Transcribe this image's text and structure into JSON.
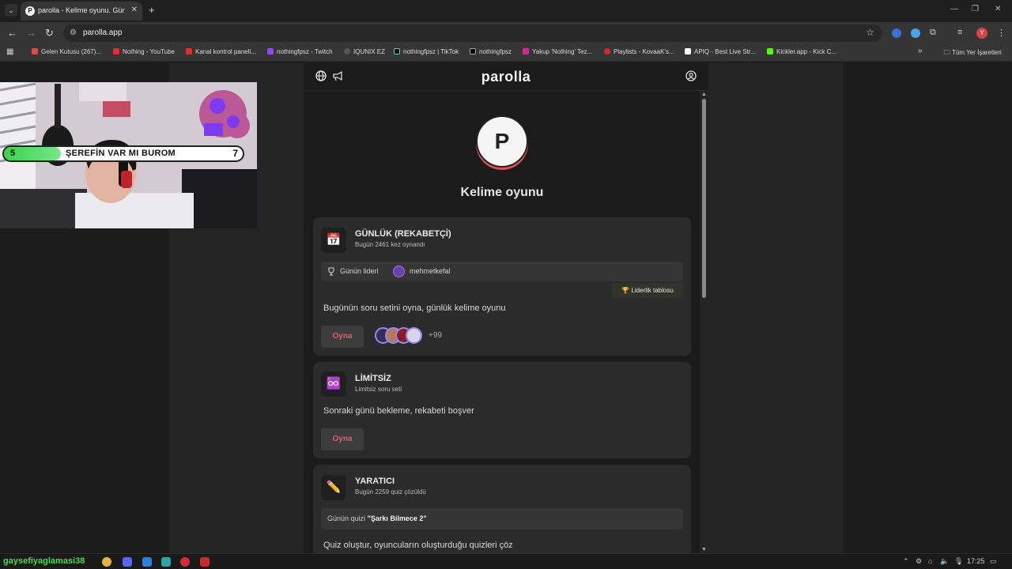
{
  "browser": {
    "tab": {
      "title": "parolla - Kelime oyunu. Günlük"
    },
    "url": "parolla.app",
    "bookmarks": [
      "Gelen Kutusu (267)...",
      "Nothing - YouTube",
      "Kanal kontrol paneli...",
      "nothingfpsz - Twitch",
      "IQUNIX EZ",
      "nothingfpsz | TikTok",
      "nothingfpsz",
      "Yakup 'Nothing' Tez...",
      "Playlists - KovaaK's...",
      "APIQ - Best Live Str...",
      "Kickler.app - Kick C..."
    ],
    "all_bookmarks": "Tüm Yer İşaretleri",
    "profile_initial": "Y"
  },
  "app": {
    "brand": "parolla",
    "logo_letter": "P",
    "subtitle": "Kelime oyunu"
  },
  "cards": {
    "daily": {
      "icon": "📅",
      "title": "GÜNLÜK (REKABETÇİ)",
      "meta": "Bugün 2461 kez oynandı",
      "leader_label": "Günün lideri",
      "leader_name": "mehmetkefal",
      "leaderboard": "🏆 Liderlik tablosu",
      "desc": "Bugünün soru setini oyna, günlük kelime oyunu",
      "play": "Oyna",
      "more_players": "+99"
    },
    "unlimited": {
      "icon": "♾️",
      "title": "LİMİTSİZ",
      "meta": "Limitsiz soru seti",
      "desc": "Sonraki günü bekleme, rekabeti boşver",
      "play": "Oyna"
    },
    "creative": {
      "icon": "✏️",
      "title": "YARATICI",
      "meta": "Bugün 2259 quiz çözüldü",
      "quiz_label": "Günün quizi",
      "quiz_name": "\"Şarkı Bilmece 2\"",
      "desc": "Quiz oluştur, oyuncuların oluşturduğu quizleri çöz"
    }
  },
  "overlay": {
    "left_num": "5",
    "title": "ŞEREFİN VAR MI BUROM",
    "right_num": "7",
    "progress": 0.24
  },
  "taskbar": {
    "name": "gaysefiyaglamasi38",
    "time": "17:25"
  }
}
